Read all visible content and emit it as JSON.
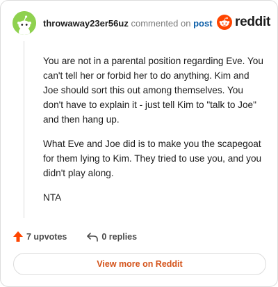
{
  "header": {
    "username": "throwaway23er56uz",
    "commented_text": "commented on",
    "post_link": "post",
    "brand": "reddit",
    "avatar_icon": "snoo-avatar-icon",
    "avatar_color": "#8fd14f"
  },
  "comment": {
    "paragraphs": [
      "You are not in a parental position regarding Eve. You can't tell her or forbid her to do anything. Kim and Joe should sort this out among themselves. You don't have to explain it - just tell Kim to \"talk to Joe\" and then hang up.",
      "What Eve and Joe did is to make you the scapegoat for them lying to Kim. They tried to use you, and you didn't play along.",
      "NTA"
    ]
  },
  "actions": {
    "upvotes": "7 upvotes",
    "replies": "0 replies",
    "upvote_icon": "upvote-arrow-icon",
    "reply_icon": "reply-arrow-icon"
  },
  "footer": {
    "view_more": "View more on Reddit"
  },
  "colors": {
    "accent": "#ff4500",
    "link": "#0b5ea8",
    "view_more": "#d4531a"
  }
}
